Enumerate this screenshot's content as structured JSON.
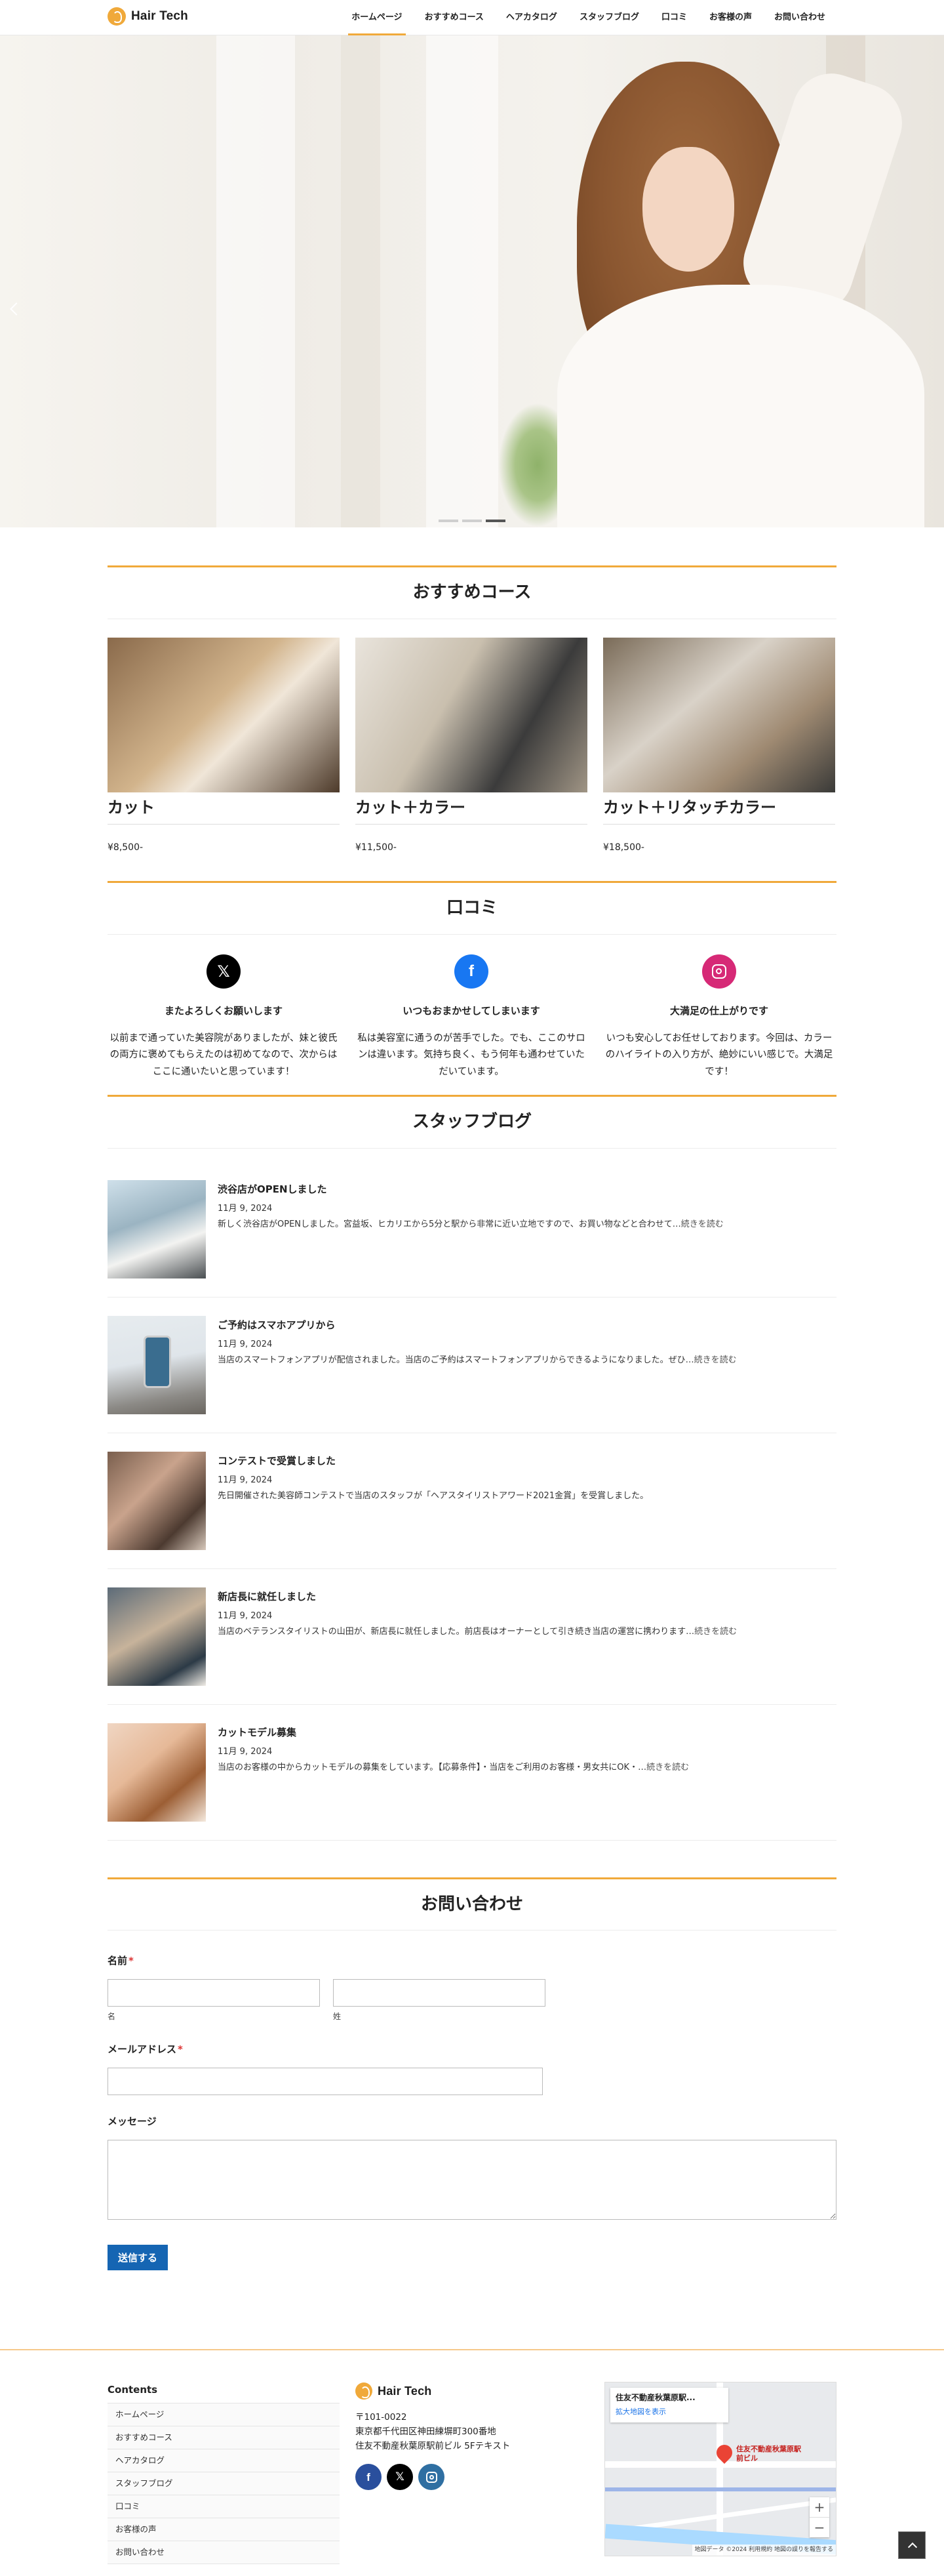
{
  "site": {
    "brand": "Hair Tech"
  },
  "nav": [
    {
      "label": "ホームページ",
      "active": true
    },
    {
      "label": "おすすめコース"
    },
    {
      "label": "ヘアカタログ"
    },
    {
      "label": "スタッフブログ"
    },
    {
      "label": "口コミ"
    },
    {
      "label": "お客様の声"
    },
    {
      "label": "お問い合わせ"
    }
  ],
  "hero": {
    "slide_count": 3,
    "active_slide": 3
  },
  "courses": {
    "title": "おすすめコース",
    "items": [
      {
        "name": "カット",
        "price": "¥8,500-"
      },
      {
        "name": "カット＋カラー",
        "price": "¥11,500-"
      },
      {
        "name": "カット＋リタッチカラー",
        "price": "¥18,500-"
      }
    ]
  },
  "reviews": {
    "title": "口コミ",
    "items": [
      {
        "icon": "x-icon",
        "title": "またよろしくお願いします",
        "body": "以前まで通っていた美容院がありましたが、妹と彼氏の両方に褒めてもらえたのは初めてなので、次からはここに通いたいと思っています！"
      },
      {
        "icon": "facebook-icon",
        "title": "いつもおまかせしてしまいます",
        "body": "私は美容室に通うのが苦手でした。でも、ここのサロンは違います。気持ち良く、もう何年も通わせていただいています。"
      },
      {
        "icon": "instagram-icon",
        "title": "大満足の仕上がりです",
        "body": "いつも安心してお任せしております。今回は、カラーのハイライトの入り方が、絶妙にいい感じで。大満足です！"
      }
    ]
  },
  "blog": {
    "title": "スタッフブログ",
    "read_more": "続きを読む",
    "posts": [
      {
        "title": "渋谷店がOPENしました",
        "date": "11月 9, 2024",
        "excerpt": "新しく渋谷店がOPENしました。宮益坂、ヒカリエから5分と駅から非常に近い立地ですので、お買い物などと合わせて…"
      },
      {
        "title": "ご予約はスマホアプリから",
        "date": "11月 9, 2024",
        "excerpt": "当店のスマートフォンアプリが配信されました。当店のご予約はスマートフォンアプリからできるようになりました。ぜひ…"
      },
      {
        "title": "コンテストで受賞しました",
        "date": "11月 9, 2024",
        "excerpt": "先日開催された美容師コンテストで当店のスタッフが「ヘアスタイリストアワード2021金賞」を受賞しました。",
        "no_more": true
      },
      {
        "title": "新店長に就任しました",
        "date": "11月 9, 2024",
        "excerpt": "当店のベテランスタイリストの山田が、新店長に就任しました。前店長はオーナーとして引き続き当店の運営に携わります…"
      },
      {
        "title": "カットモデル募集",
        "date": "11月 9, 2024",
        "excerpt": "当店のお客様の中からカットモデルの募集をしています。【応募条件】・当店をご利用のお客様・男女共にOK・…"
      }
    ]
  },
  "contact": {
    "title": "お問い合わせ",
    "name_label": "名前",
    "first_sub": "名",
    "last_sub": "姓",
    "email_label": "メールアドレス",
    "message_label": "メッセージ",
    "required_mark": "*",
    "submit": "送信する"
  },
  "footer": {
    "contents_heading": "Contents",
    "links": [
      "ホームページ",
      "おすすめコース",
      "ヘアカタログ",
      "スタッフブログ",
      "口コミ",
      "お客様の声",
      "お問い合わせ"
    ],
    "brand": "Hair Tech",
    "postal": "〒101-0022",
    "address1": "東京都千代田区神田練塀町300番地",
    "address2": "住友不動産秋葉原駅前ビル 5Fテキスト",
    "map": {
      "card_title": "住友不動産秋葉原駅...",
      "card_link": "拡大地図を表示",
      "place_label": "住友不動産秋葉原駅前ビル",
      "attribution": "地図データ ©2024 利用規約 地図の誤りを報告する"
    }
  },
  "colors": {
    "accent": "#f0a93a",
    "button": "#1565b3",
    "facebook": "#1877f2",
    "instagram": "#d62976"
  }
}
